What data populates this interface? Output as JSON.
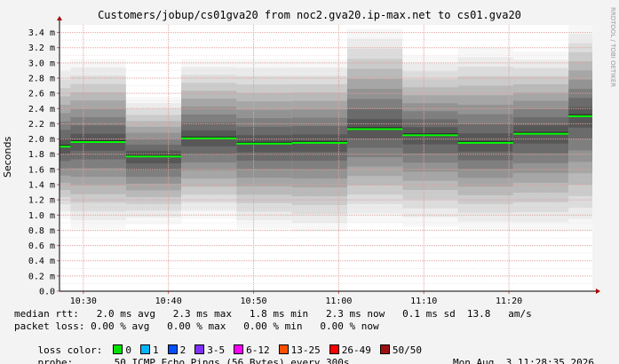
{
  "title": "Customers/jobup/cs01gva20 from noc2.gva20.ip-max.net to cs01.gva20",
  "side_text": "RRDTOOL / TOBI OETIKER",
  "colors": {
    "median": "#00ff00",
    "grid": "#e0a0a0",
    "background": "#f3f3f3",
    "plot_bg": "#ffffff"
  },
  "chart_data": {
    "type": "area",
    "title": "Customers/jobup/cs01gva20 from noc2.gva20.ip-max.net to cs01.gva20",
    "ylabel": "Seconds",
    "ylim": [
      0,
      3.5
    ],
    "yticks": [
      0.0,
      0.2,
      0.4,
      0.6,
      0.8,
      1.0,
      1.2,
      1.4,
      1.6,
      1.8,
      2.0,
      2.2,
      2.4,
      2.6,
      2.8,
      3.0,
      3.2,
      3.4
    ],
    "ytick_labels": [
      "0.0",
      "0.2 m",
      "0.4 m",
      "0.6 m",
      "0.8 m",
      "1.0 m",
      "1.2 m",
      "1.4 m",
      "1.6 m",
      "1.8 m",
      "2.0 m",
      "2.2 m",
      "2.4 m",
      "2.6 m",
      "2.8 m",
      "3.0 m",
      "3.2 m",
      "3.4 m"
    ],
    "xticks": [
      "10:30",
      "10:40",
      "10:50",
      "11:00",
      "11:10",
      "11:20"
    ],
    "xtick_minutes": [
      30,
      40,
      50,
      60,
      70,
      80
    ],
    "x_range_minutes": [
      27.2,
      89.8
    ],
    "grid": true,
    "series": [
      {
        "name": "median rtt",
        "segments": [
          {
            "start": 27.2,
            "end": 28.5,
            "median": 1.9,
            "min": 0.95,
            "max": 3.0
          },
          {
            "start": 28.5,
            "end": 35.0,
            "median": 1.96,
            "min": 0.82,
            "max": 3.05
          },
          {
            "start": 35.0,
            "end": 41.5,
            "median": 1.77,
            "min": 0.88,
            "max": 2.55
          },
          {
            "start": 41.5,
            "end": 48.0,
            "median": 2.01,
            "min": 0.95,
            "max": 3.05
          },
          {
            "start": 48.0,
            "end": 54.5,
            "median": 1.94,
            "min": 0.82,
            "max": 3.05
          },
          {
            "start": 54.5,
            "end": 61.0,
            "median": 1.95,
            "min": 0.78,
            "max": 3.05
          },
          {
            "start": 61.0,
            "end": 67.5,
            "median": 2.13,
            "min": 0.9,
            "max": 3.45
          },
          {
            "start": 67.5,
            "end": 74.0,
            "median": 2.05,
            "min": 0.85,
            "max": 3.1
          },
          {
            "start": 74.0,
            "end": 80.5,
            "median": 1.95,
            "min": 0.8,
            "max": 3.2
          },
          {
            "start": 80.5,
            "end": 87.0,
            "median": 2.07,
            "min": 0.78,
            "max": 3.15
          },
          {
            "start": 87.0,
            "end": 93.5,
            "median": 2.3,
            "min": 0.8,
            "max": 3.5
          },
          {
            "start": 93.5,
            "end": 100.0,
            "median": 2.32,
            "min": 0.85,
            "max": 3.5
          }
        ]
      }
    ]
  },
  "legend": {
    "median_rtt": "median rtt:   2.0 ms avg   2.3 ms max   1.8 ms min   2.3 ms now   0.1 ms sd  13.8   am/s",
    "packet_loss": "packet loss: 0.00 % avg   0.00 % max   0.00 % min   0.00 % now",
    "loss_color_label": "loss color:",
    "loss_colors": [
      {
        "label": "0",
        "color": "#00e000"
      },
      {
        "label": "1",
        "color": "#00b4ff"
      },
      {
        "label": "2",
        "color": "#0050ff"
      },
      {
        "label": "3-5",
        "color": "#7f2fff"
      },
      {
        "label": "6-12",
        "color": "#ff00ff"
      },
      {
        "label": "13-25",
        "color": "#ff5000"
      },
      {
        "label": "26-49",
        "color": "#ff0000"
      },
      {
        "label": "50/50",
        "color": "#a01010"
      }
    ],
    "probe": "probe:       50 ICMP Echo Pings (56 Bytes) every 300s",
    "date": "Mon Aug  3 11:28:35 2026"
  }
}
